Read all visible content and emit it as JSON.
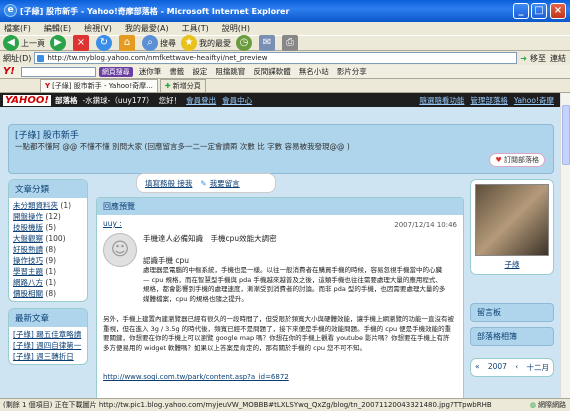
{
  "window": {
    "title": "[子綠] 股市新手 - Yahoo!奇摩部落格 - Microsoft Internet Explorer"
  },
  "menu": [
    "檔案(F)",
    "編輯(E)",
    "檢視(V)",
    "我的最愛(A)",
    "工具(T)",
    "說明(H)"
  ],
  "toolbar": {
    "back": "上一頁",
    "search": "搜尋",
    "favorites": "我的最愛"
  },
  "address": {
    "label": "網址(D)",
    "url": "http://tw.myblog.yahoo.com/nmfkettwave-heaiftyi/net_preview",
    "go": "移至",
    "links": "連結"
  },
  "yahoo_toolbar": {
    "search_button": "網頁搜尋",
    "items": [
      "迷你筆",
      "書籤",
      "設定",
      "阻擋跳窗",
      "反間諜軟體",
      "無名小站",
      "影片分享"
    ]
  },
  "tabs": [
    "[子綠] 股市新手 - Yahoo!奇摩...",
    "新增分頁"
  ],
  "blog_topbar": {
    "tag": "部落格",
    "user": "-水鑽球-（uuy177）",
    "welcome": "您好！",
    "links": [
      "會員登出",
      "會員中心"
    ],
    "right_links": [
      "隨選隨看功能",
      "管理部落格",
      "Yahoo!奇摩"
    ]
  },
  "header": {
    "title": "[子綠] 股市新手",
    "desc": "一點都不懂阿 @@ 不懂不懂 別問大家 (回應留言多一二一定會讀兩 次數 比 字數 容易被我發現@@ )",
    "subscribe": "訂閱部落格"
  },
  "speech": {
    "links": [
      "填寫務般 接我",
      "我要留言"
    ]
  },
  "categories": {
    "title": "文章分類",
    "items": [
      {
        "name": "未分類資料夾",
        "count": "(1)"
      },
      {
        "name": "開盤操作",
        "count": "(12)"
      },
      {
        "name": "技股機版",
        "count": "(5)"
      },
      {
        "name": "大盤觀察",
        "count": "(100)"
      },
      {
        "name": "好股熟讀",
        "count": "(8)"
      },
      {
        "name": "操作技巧",
        "count": "(9)"
      },
      {
        "name": "學習主題",
        "count": "(1)"
      },
      {
        "name": "網路八方",
        "count": "(1)"
      },
      {
        "name": "價股相關",
        "count": "(8)"
      }
    ]
  },
  "recent": {
    "title": "最新文章",
    "items": [
      "[子綠] 踢五佳章略讀",
      "[子綠] 週四自律第一",
      "[子綠] 週三轉折日"
    ]
  },
  "preview": {
    "title": "回應預覽",
    "author": "uuy :",
    "date": "2007/12/14 10:46",
    "subject": "手機達人必備知識　手機cpu效能大調密",
    "p1": "認識手機 cpu",
    "p2": "處理器是電腦的中樞系統，手機也是一樣。以往一般消費者在購買手機的時候，容易忽視手機當中的心臟 — cpu 規格，而在智慧型手機與 pda 手機越來越普及之後，這類手機也往往需要處理大量的應用程式、規格，都會影響到手機的處理速度，漸漸受到消費者的討論。而非 pda 型的手機，也因需要處理大量的多媒體檔案，cpu 的規格也隨之提升。",
    "p3": "另外，手機上建置內建瀏覽器已經有很久的一段時間了，但受限於頻寬大小與硬體效能，讓手機上網瀏覽的功能一直沒有被重視，但在進入 3g / 3.5g 的時代後，頻寬已經不是問題了，接下來便是手機的效能問題。手機的 cpu 便是手機效能的重要關鍵，你想要在你的手機上可以瀏覽 google map 嗎？你想在你的手機上觀看 youtube 影片嗎？你想要在手機上有許多方便易用的 widget 軟體嗎？如果以上答案是肯定的，那有關於手機的 cpu 您不可不知。",
    "link": "http://www.sogi.com.tw/park/content.asp?a_id=6872"
  },
  "profile": {
    "name": "子綠"
  },
  "right_buttons": [
    "留言板",
    "部落格相簿"
  ],
  "calendar": {
    "year": "2007",
    "month": "十二月"
  },
  "status": {
    "text": "(剩餘 1 個項目) 正在下載圖片 http://tw.pic1.blog.yahoo.com/myjeuVW_MOBBB#tLXLSYwq_QxZg/blog/tn_20071120043321480.jpg?TTpwbRHB",
    "zone": "網際網路"
  }
}
